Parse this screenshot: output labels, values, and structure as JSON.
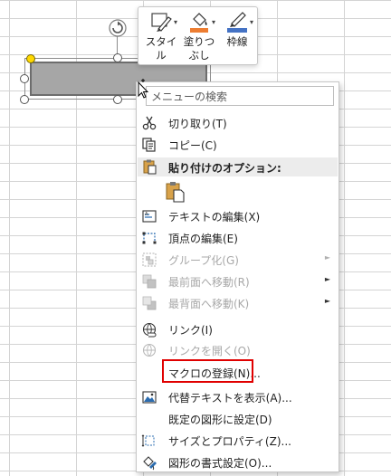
{
  "mini_toolbar": {
    "buttons": [
      {
        "label_line1": "スタイ",
        "label_line2": "ル",
        "icon": "shape-style-icon"
      },
      {
        "label_line1": "塗りつ",
        "label_line2": "ぶし",
        "icon": "paint-bucket-icon",
        "accent": "#ed7d31"
      },
      {
        "label_line1": "枠線",
        "label_line2": "",
        "icon": "pen-outline-icon",
        "accent": "#4472c4"
      }
    ]
  },
  "context_menu": {
    "search_placeholder": "メニューの検索",
    "items": [
      {
        "label": "切り取り(T)",
        "icon": "scissors-icon",
        "enabled": true
      },
      {
        "label": "コピー(C)",
        "icon": "copy-icon",
        "enabled": true
      },
      {
        "label": "テキストの編集(X)",
        "icon": "edit-text-icon",
        "enabled": true
      },
      {
        "label": "頂点の編集(E)",
        "icon": "edit-points-icon",
        "enabled": true
      },
      {
        "label": "グループ化(G)",
        "icon": "group-icon",
        "enabled": false,
        "submenu": true
      },
      {
        "label": "最前面へ移動(R)",
        "icon": "bring-front-icon",
        "enabled": false,
        "submenu": true
      },
      {
        "label": "最背面へ移動(K)",
        "icon": "send-back-icon",
        "enabled": false,
        "submenu": true
      },
      {
        "label": "リンク(I)",
        "icon": "link-icon",
        "enabled": true
      },
      {
        "label": "リンクを開く(O)",
        "icon": "open-link-icon",
        "enabled": false
      },
      {
        "label": "マクロの登録(N)...",
        "icon": "",
        "enabled": true,
        "highlighted": true
      },
      {
        "label": "代替テキストを表示(A)...",
        "icon": "alt-text-icon",
        "enabled": true
      },
      {
        "label": "既定の図形に設定(D)",
        "icon": "",
        "enabled": true
      },
      {
        "label": "サイズとプロパティ(Z)...",
        "icon": "size-properties-icon",
        "enabled": true
      },
      {
        "label": "図形の書式設定(O)...",
        "icon": "format-shape-icon",
        "enabled": true
      }
    ],
    "paste_options_header": "貼り付けのオプション:",
    "highlight_color": "#e00000"
  }
}
